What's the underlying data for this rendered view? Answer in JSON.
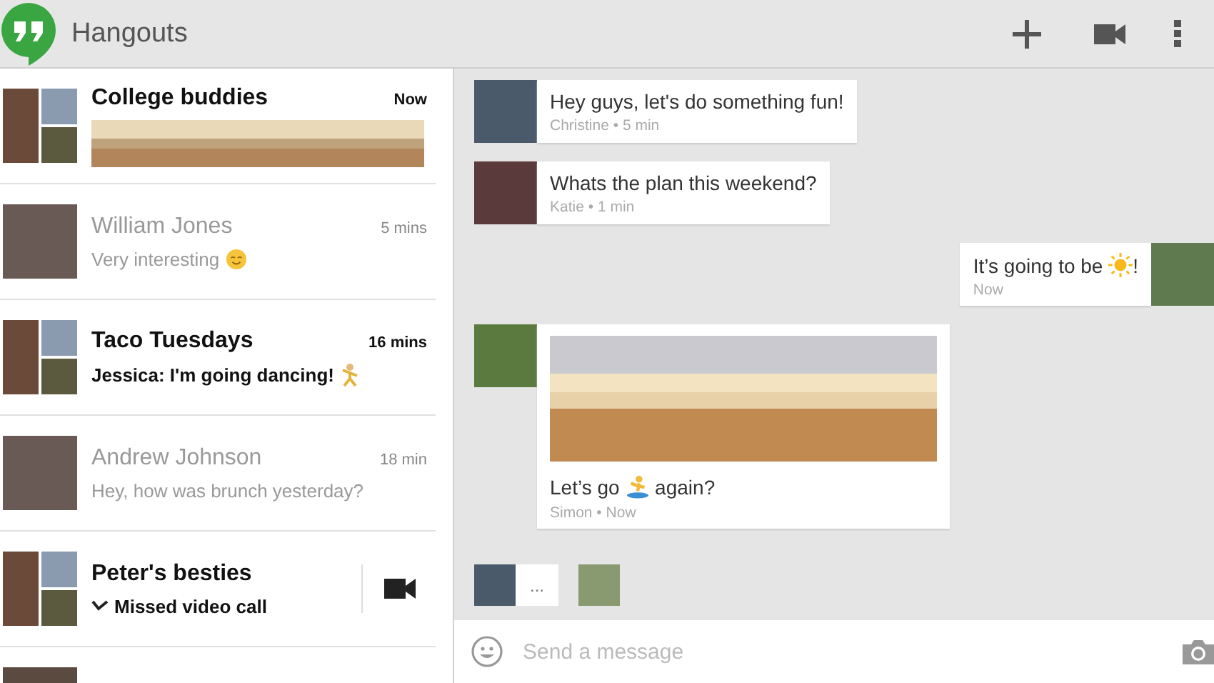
{
  "app_bar": {
    "title": "Hangouts"
  },
  "conversations": [
    {
      "name": "College buddies",
      "time": "Now",
      "unread": true,
      "group": true,
      "kind": "photo"
    },
    {
      "name": "William Jones",
      "time": "5 mins",
      "unread": false,
      "group": false,
      "kind": "text",
      "preview": "Very interesting",
      "inline_icon": {
        "kind": "smile"
      }
    },
    {
      "name": "Taco Tuesdays",
      "time": "16 mins",
      "unread": true,
      "group": true,
      "kind": "text",
      "preview": "Jessica: I'm going dancing!",
      "inline_icon": {
        "kind": "dancer"
      }
    },
    {
      "name": "Andrew Johnson",
      "time": "18 min",
      "unread": false,
      "group": false,
      "kind": "text",
      "preview": "Hey, how was brunch yesterday?"
    },
    {
      "name": "Peter's besties",
      "unread": true,
      "group": true,
      "kind": "missed_call",
      "preview": "Missed video call"
    }
  ],
  "messages": [
    {
      "outgoing": false,
      "kind": "text",
      "text": "Hey guys, let's do something fun!",
      "meta": "Christine • 5 min"
    },
    {
      "outgoing": false,
      "kind": "text",
      "text": "Whats the plan this weekend?",
      "meta": "Katie • 1 min"
    },
    {
      "outgoing": true,
      "kind": "text",
      "text": "It’s going to be ",
      "inline_icon": {
        "kind": "sun"
      },
      "text_end": "!",
      "meta": "Now"
    },
    {
      "outgoing": false,
      "kind": "photo",
      "text": "Let’s go ",
      "inline_icon": {
        "kind": "surfer"
      },
      "text_end": " again?",
      "meta": "Simon • Now"
    }
  ],
  "typing": {
    "indicator": "..."
  },
  "composer": {
    "placeholder": "Send a message"
  }
}
